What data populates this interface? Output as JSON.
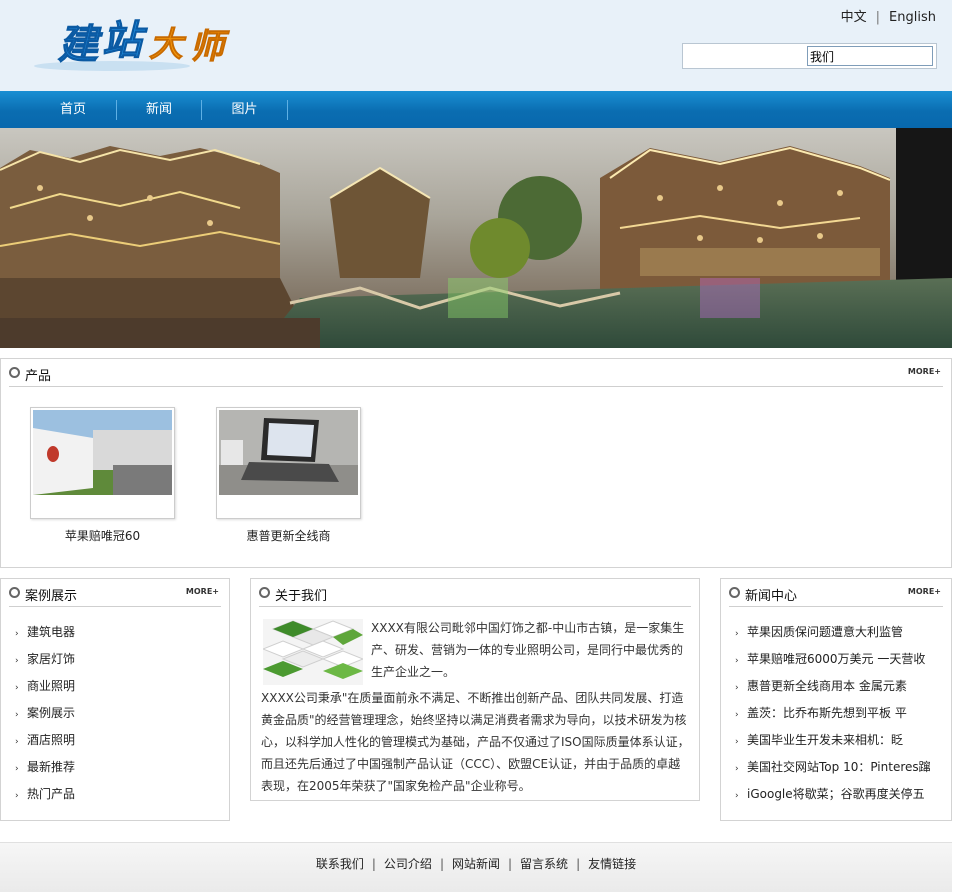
{
  "header": {
    "logo_text": "建站大师",
    "lang_cn": "中文",
    "lang_sep": "|",
    "lang_en": "English",
    "search_value": "我们"
  },
  "nav": {
    "items": [
      {
        "label": "首页"
      },
      {
        "label": "新闻"
      },
      {
        "label": "图片"
      }
    ]
  },
  "products": {
    "title": "产品",
    "more": "MORE+",
    "items": [
      {
        "name": "苹果赔唯冠60"
      },
      {
        "name": "惠普更新全线商"
      }
    ]
  },
  "cases": {
    "title": "案例展示",
    "more": "MORE+",
    "items": [
      "建筑电器",
      "家居灯饰",
      "商业照明",
      "案例展示",
      "酒店照明",
      "最新推荐",
      "热门产品"
    ]
  },
  "about": {
    "title": "关于我们",
    "para1": "XXXX有限公司毗邻中国灯饰之都-中山市古镇，是一家集生产、研发、营销为一体的专业照明公司，是同行中最优秀的生产企业之一。",
    "para2": "XXXX公司秉承\"在质量面前永不满足、不断推出创新产品、团队共同发展、打造黄金品质\"的经营管理理念，始终坚持以满足消费者需求为导向，以技术研发为核心，以科学加人性化的管理模式为基础，产品不仅通过了ISO国际质量体系认证，而且还先后通过了中国强制产品认证（CCC）、欧盟CE认证，并由于品质的卓越表现，在2005年荣获了\"国家免检产品\"企业称号。"
  },
  "news": {
    "title": "新闻中心",
    "more": "MORE+",
    "items": [
      "苹果因质保问题遭意大利监管",
      "苹果赔唯冠6000万美元 一天营收",
      "惠普更新全线商用本 金属元素",
      "盖茨：比乔布斯先想到平板 平",
      "美国毕业生开发未来相机：眨",
      "美国社交网站Top 10：Pinteres蹿",
      "iGoogle将歇菜；谷歌再度关停五"
    ]
  },
  "footer": {
    "links": [
      "联系我们",
      "公司介绍",
      "网站新闻",
      "留言系统",
      "友情链接"
    ],
    "sep": "|"
  },
  "colors": {
    "nav_blue": "#0a6db1",
    "header_bg": "#e8f1f9",
    "logo_blue": "#1a7fd1",
    "logo_orange": "#f08a00"
  }
}
